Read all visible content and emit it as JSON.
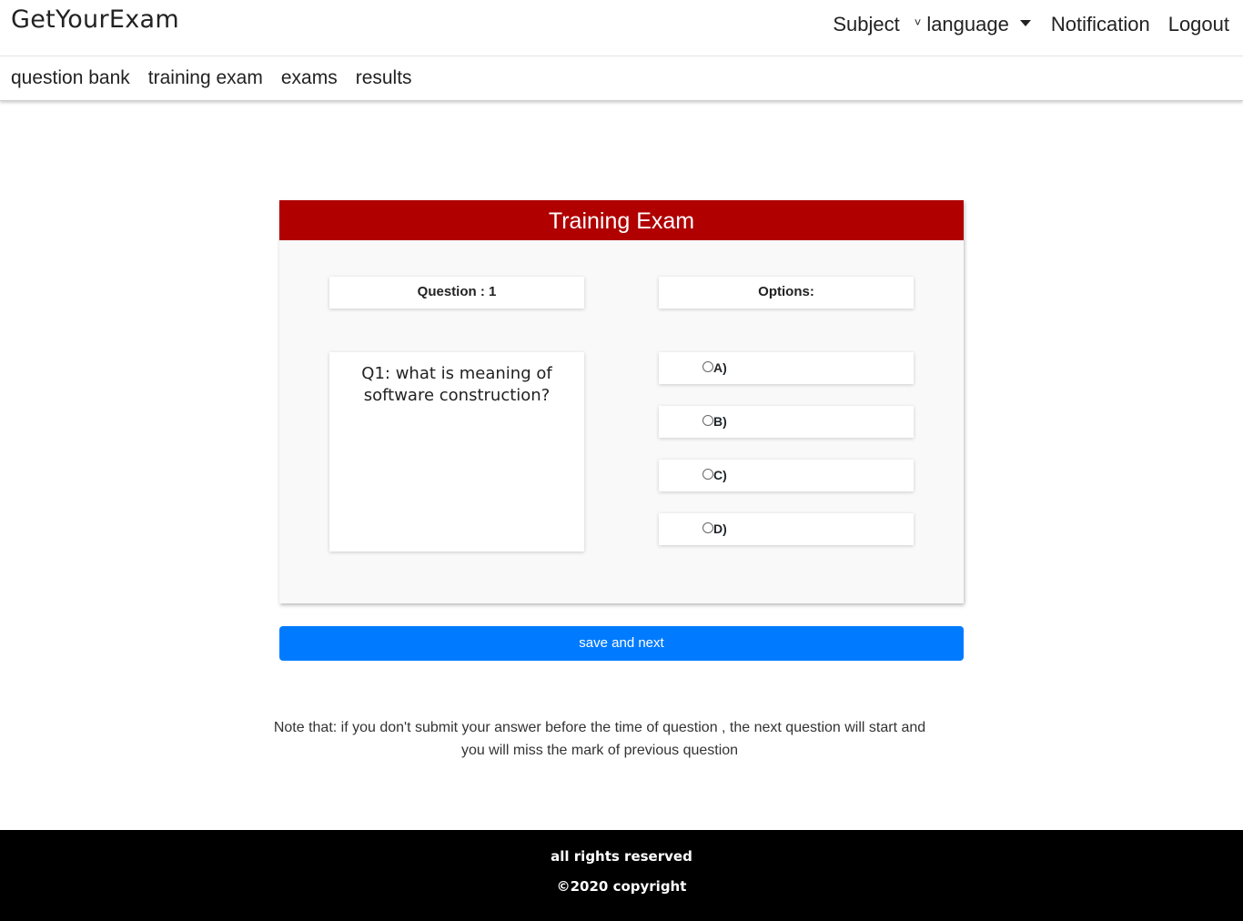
{
  "brand": "GetYourExam",
  "topnav": {
    "subject": "Subject",
    "chevron": "˅",
    "language": "language",
    "notification": "Notification",
    "logout": "Logout"
  },
  "subnav": [
    "question bank",
    "training exam",
    "exams",
    "results"
  ],
  "exam": {
    "title": "Training Exam",
    "question_header": "Question : 1",
    "options_header": "Options:",
    "question_text": "Q1: what is meaning of software construction?",
    "options": [
      "A)",
      "B)",
      "C)",
      "D)"
    ],
    "options_selected": null
  },
  "button": "save and next",
  "note": "Note that: if you don't submit your answer before the time of question , the next question will start and you will miss the mark of previous question",
  "footer": {
    "line1": "all rights reserved",
    "line2": "©2020 copyright"
  },
  "colors": {
    "header_red": "#b00000",
    "button_blue": "#007bff",
    "footer_black": "#000000"
  }
}
